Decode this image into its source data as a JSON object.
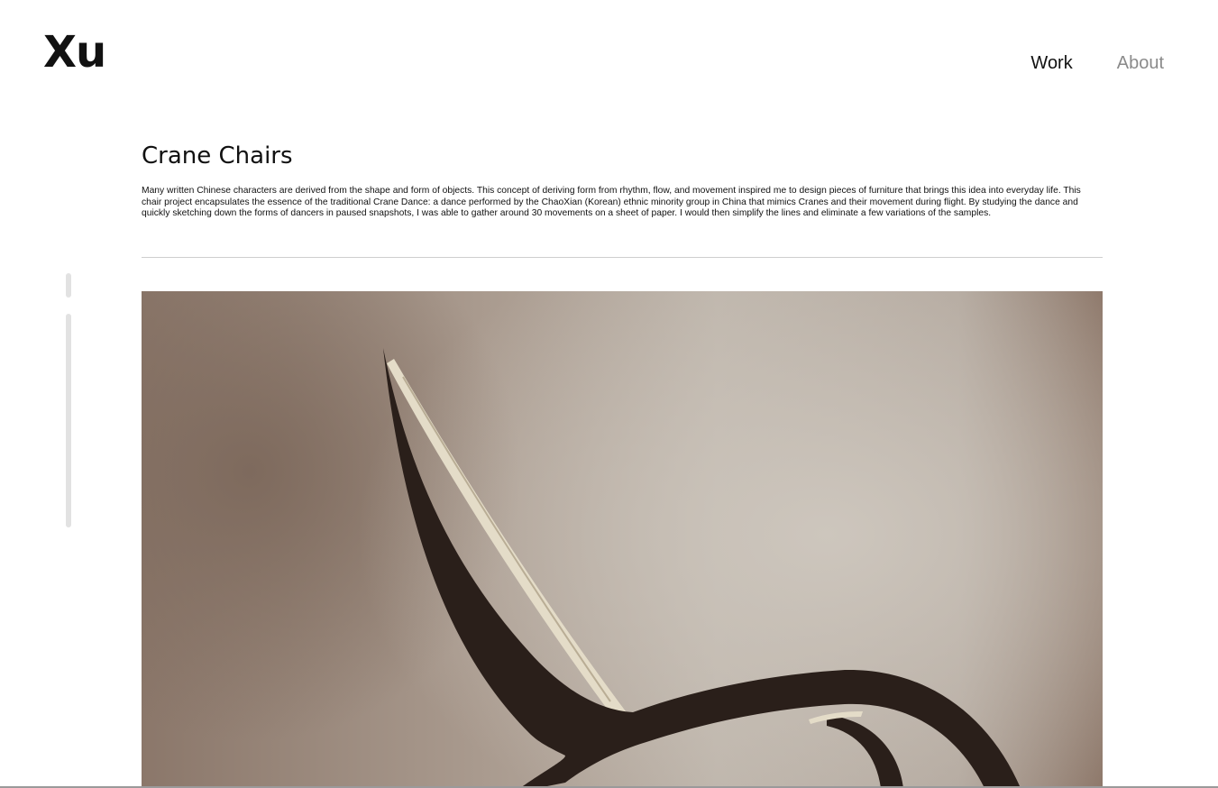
{
  "header": {
    "logo": "Xu",
    "nav": [
      {
        "label": "Work",
        "active": true
      },
      {
        "label": "About",
        "active": false
      }
    ]
  },
  "project": {
    "title": "Crane Chairs",
    "description": "Many written Chinese characters are derived from the shape and form of objects. This concept of deriving form from rhythm, flow, and movement inspired me to design pieces of furniture that brings this idea into everyday life. This chair project encapsulates the essence of the traditional Crane Dance: a dance performed by the ChaoXian (Korean) ethnic minority group in China that mimics Cranes and their movement during flight. By studying the dance and quickly sketching down the forms of dancers in paused snapshots, I was able to gather around 30 movements on a sheet of paper. I would then simplify the lines and eliminate a few variations of the samples."
  },
  "colors": {
    "text": "#111111",
    "nav_inactive": "#8a8a8a",
    "divider": "#cfcfcf",
    "scroll_indicator": "#e2e2e2",
    "chair": "#2a1f1a",
    "weave": "#e4dcc8"
  }
}
